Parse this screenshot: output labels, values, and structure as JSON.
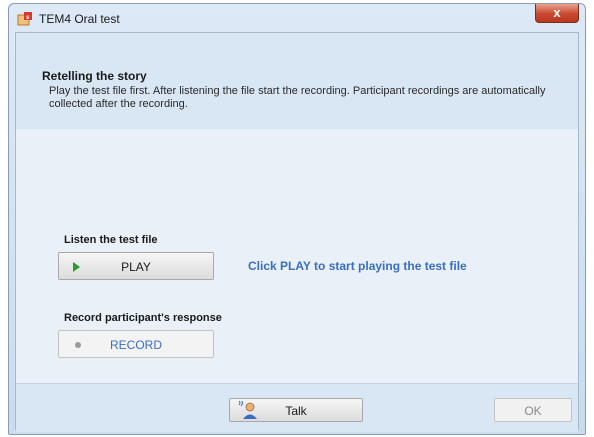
{
  "window": {
    "title": "TEM4 Oral test",
    "close_label": "x"
  },
  "header": {
    "title": "Retelling the story",
    "description": "Play the test file first. After listening the file start the recording. Participant recordings are automatically collected after the recording."
  },
  "listen": {
    "label": "Listen the test file",
    "play_button": "PLAY",
    "hint": "Click PLAY to start playing the test file"
  },
  "record": {
    "label": "Record participant's response",
    "record_button": "RECORD"
  },
  "footer": {
    "talk_button": "Talk",
    "ok_button": "OK"
  },
  "colors": {
    "accent_text": "#3a6ec0",
    "play_icon": "#2c9a2c",
    "close_button": "#c9482e"
  }
}
